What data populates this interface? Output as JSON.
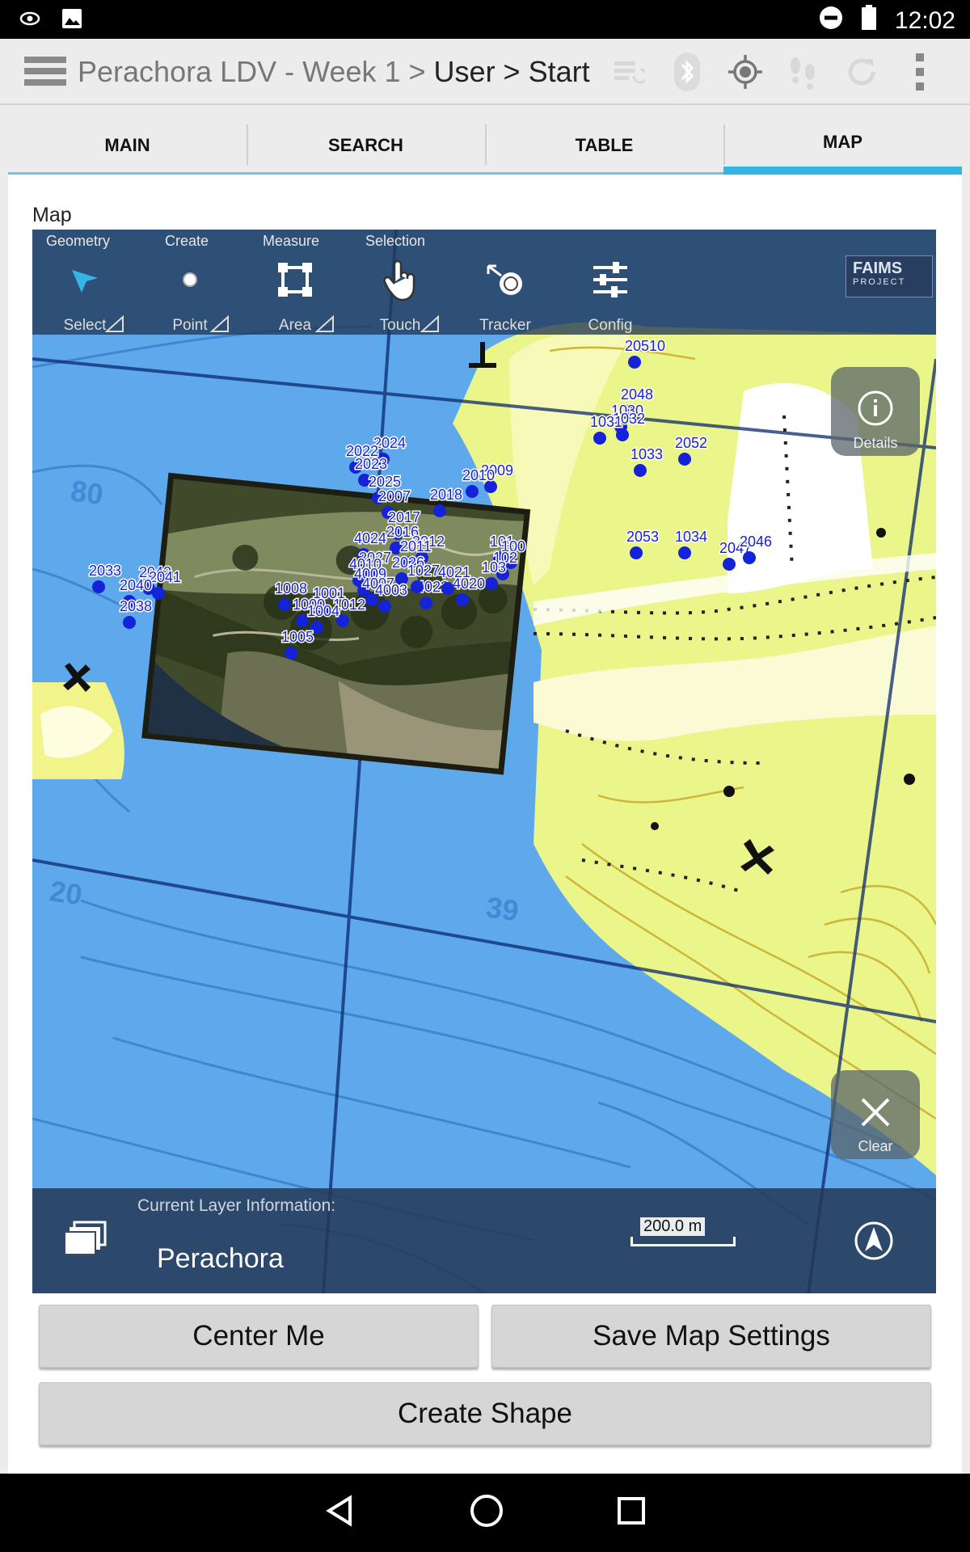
{
  "status_bar": {
    "time": "12:02",
    "icons": [
      "eye-icon",
      "image-icon",
      "do-not-disturb-icon",
      "battery-icon"
    ]
  },
  "action_bar": {
    "title": "Perachora LDV - Week 1 > ",
    "crumb": "User > Start",
    "icons": [
      "sync-icon",
      "bluetooth-icon",
      "gps-icon",
      "tracker-icon",
      "refresh-icon",
      "overflow-menu-icon"
    ]
  },
  "tabs": [
    {
      "label": "MAIN",
      "active": false
    },
    {
      "label": "SEARCH",
      "active": false
    },
    {
      "label": "TABLE",
      "active": false
    },
    {
      "label": "MAP",
      "active": true
    }
  ],
  "map": {
    "label": "Map",
    "toolbar": {
      "groups": {
        "geometry": "Geometry",
        "create": "Create",
        "measure": "Measure",
        "selection": "Selection"
      },
      "tools": {
        "select": "Select",
        "point": "Point",
        "area": "Area",
        "touch": "Touch",
        "tracker": "Tracker",
        "config": "Config"
      }
    },
    "logo": {
      "main": "FAIMS",
      "sub": "PROJECT"
    },
    "details_label": "Details",
    "clear_label": "Clear",
    "layer_caption": "Current Layer Information:",
    "layer_name": "Perachora",
    "scale_label": "200.0 m",
    "point_labels": [
      "20510",
      "2048",
      "1030",
      "1032",
      "1031",
      "1033",
      "2052",
      "2053",
      "1034",
      "2047",
      "2046",
      "2024",
      "2022",
      "2023",
      "2025",
      "2009",
      "2010",
      "2018",
      "2007",
      "2017",
      "2016",
      "4024",
      "2012",
      "2011",
      "2027",
      "4010",
      "2026",
      "4009",
      "4007",
      "4003",
      "4022",
      "101",
      "100",
      "102",
      "103",
      "4020",
      "4021",
      "1027",
      "1008",
      "1001",
      "1000",
      "1012",
      "1004",
      "1005",
      "2042",
      "2041",
      "2040",
      "2038",
      "2033"
    ]
  },
  "buttons": {
    "center_me": "Center Me",
    "save_map_settings": "Save Map Settings",
    "create_shape": "Create Shape"
  },
  "nav_bar": {
    "icons": [
      "back-icon",
      "home-icon",
      "recents-icon"
    ]
  }
}
